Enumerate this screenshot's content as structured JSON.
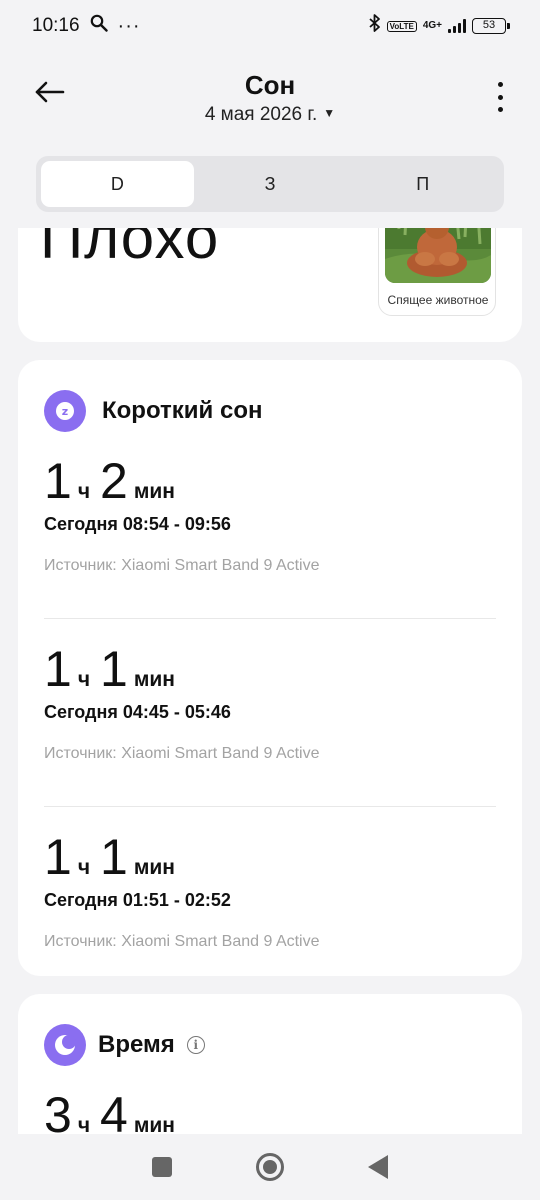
{
  "status_bar": {
    "time": "10:16",
    "network": "4G+",
    "volte": "VoLTE",
    "battery": "53"
  },
  "header": {
    "title": "Сон",
    "date": "4 мая 2026 г."
  },
  "tabs": [
    {
      "label": "D",
      "active": true
    },
    {
      "label": "З",
      "active": false
    },
    {
      "label": "П",
      "active": false
    }
  ],
  "summary": {
    "rating": "Плохо",
    "animal_caption": "Спящее животное"
  },
  "nap_card": {
    "title": "Короткий сон",
    "sessions": [
      {
        "hours": "1",
        "hours_unit": "ч",
        "minutes": "2",
        "minutes_unit": "мин",
        "range": "Сегодня 08:54 - 09:56",
        "source": "Источник: Xiaomi Smart Band 9 Active"
      },
      {
        "hours": "1",
        "hours_unit": "ч",
        "minutes": "1",
        "minutes_unit": "мин",
        "range": "Сегодня 04:45 - 05:46",
        "source": "Источник: Xiaomi Smart Band 9 Active"
      },
      {
        "hours": "1",
        "hours_unit": "ч",
        "minutes": "1",
        "minutes_unit": "мин",
        "range": "Сегодня 01:51 - 02:52",
        "source": "Источник: Xiaomi Smart Band 9 Active"
      }
    ]
  },
  "time_card": {
    "title": "Время",
    "hours": "3",
    "hours_unit": "ч",
    "minutes": "4",
    "minutes_unit": "мин"
  },
  "colors": {
    "accent": "#8a6ef0",
    "background": "#f3f3f5",
    "source_text": "#a3a3a3"
  }
}
